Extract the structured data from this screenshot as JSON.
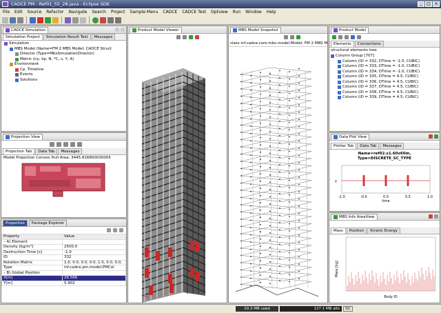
{
  "window": {
    "title": "CADCE PM - Ref01_S5_28.java - Eclipse SDK"
  },
  "menu": [
    "File",
    "Edit",
    "Source",
    "Refactor",
    "Navigate",
    "Search",
    "Project",
    "Sample Menu",
    "CADCE",
    "CADCE Test",
    "Optview",
    "Run",
    "Window",
    "Help"
  ],
  "sim": {
    "tab": "CADCE Simulation",
    "subtabs": [
      "Simulation Project",
      "Simulation Result Test",
      "Messages"
    ],
    "tree": [
      "Simulation",
      "MBS Model (Name=FM 2 MBS Model: CADCE Struct",
      "Director (Type=MbsSimulationDirector)",
      "Metric (ny, kp, N, *C, s, Y, A)",
      "Environment",
      "Cp. Timeline",
      "Events",
      "Solutions"
    ]
  },
  "proj": {
    "tab": "Projection View",
    "subtabs": [
      "Projection Tab",
      "Data Tab",
      "Messages"
    ],
    "info": "Model Projection Convex Hull Area: 3445.816800030005"
  },
  "props": {
    "tabs": [
      "Properties",
      "Package Explorer"
    ],
    "col_property": "Property",
    "col_value": "Value",
    "rows": [
      [
        "– A) Element",
        ""
      ],
      [
        "Density [kg/m³]",
        "2500.0"
      ],
      [
        "Destruction Time [s]",
        "-1.0"
      ],
      [
        "ID",
        "332"
      ],
      [
        "Rotation Matrix",
        "1.0, 0.0, 0.0, 0.0, 1.0, 0.0, 0.0,"
      ],
      [
        "Type",
        "inf.cadce.pm.model.PMCol"
      ],
      [
        "– B) Global Position",
        ""
      ],
      [
        "X[m]",
        "26.566"
      ],
      [
        "Y[m]",
        "5.902"
      ]
    ]
  },
  "viewer": {
    "tab": "Product Model Viewer"
  },
  "snapshot": {
    "tab": "MBS Model Snapshot",
    "header": "class inf.cadce.core.mbs.model.Model: FM 2 MBS Model: C"
  },
  "pm": {
    "tab": "Product Model",
    "subtabs": [
      "Elements",
      "Connections"
    ],
    "tree_title": "structural elements tree",
    "group": "Column Group [707]",
    "items": [
      "Column (ID = 332, DTime = -1.0, CUBIC)",
      "Column (ID = 333, DTime = -1.0, CUBIC)",
      "Column (ID = 334, DTime = -1.0, CUBIC)",
      "Column (ID = 335, DTime = 4.5, CUBIC)",
      "Column (ID = 336, DTime = 4.5, CUBIC)",
      "Column (ID = 337, DTime = 4.5, CUBIC)",
      "Column (ID = 338, DTime = 4.5, CUBIC)",
      "Column (ID = 339, DTime = 4.5, CUBIC)"
    ]
  },
  "plot": {
    "tab": "Data Plot View",
    "subtabs": [
      "Plotter Tab",
      "Data Tab",
      "Messages"
    ],
    "title1": "Name=ref02.s1.60x60m,",
    "title2": "Type=DISCRETE_SC_TYPE",
    "xticks": [
      "-1.0",
      "-0.5",
      "0.0",
      "0.5",
      "1.0"
    ],
    "xlabel": "time",
    "ylabel": "y",
    "chart_data": {
      "type": "scatter",
      "xlabel": "time",
      "ylabel": "y",
      "x": [
        -0.5,
        0.0,
        0.5
      ],
      "y": [
        0,
        0,
        0
      ]
    }
  },
  "mbs": {
    "tab": "MBS Info AreaView",
    "subtabs": [
      "Mass",
      "Position",
      "Kinetic Energy"
    ],
    "xlabel": "Body ID",
    "ylabel": "Mass [kg]"
  },
  "status": {
    "mem1": "20.3 MB used",
    "mem2": "127.1 MB allo",
    "gc": "GC"
  },
  "colors": {
    "accent": "#2d2d8c",
    "red": "#d23c3c"
  }
}
